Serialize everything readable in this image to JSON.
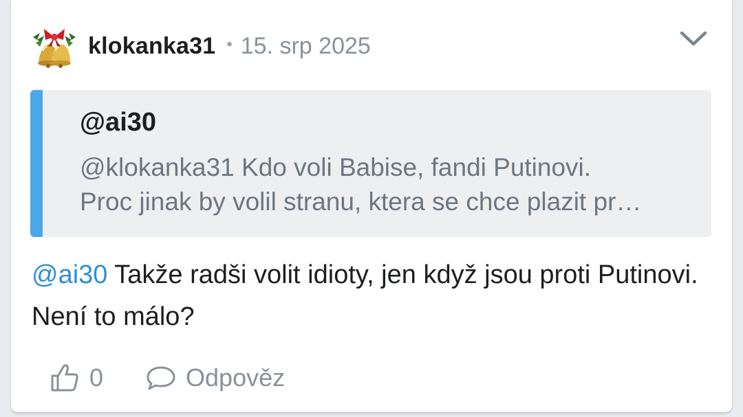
{
  "post": {
    "author": "klokanka31",
    "separator": "•",
    "date": "15. srp 2025",
    "avatar_icon": "christmas-bells-icon",
    "menu_icon": "chevron-down-icon"
  },
  "quote": {
    "author": "@ai30",
    "line1": "@klokanka31 Kdo voli Babise, fandi Putinovi.",
    "line2": "Proc jinak by volil stranu, ktera se chce plazit pr…",
    "accent_color": "#4aa8e8"
  },
  "reply": {
    "mention": "@ai30",
    "text": " Takže radši volit idioty, jen když jsou proti Putinovi. Není to málo?",
    "mention_color": "#2f8fd6"
  },
  "actions": {
    "like_icon": "thumbs-up-icon",
    "like_count": "0",
    "reply_icon": "speech-bubble-icon",
    "reply_label": "Odpověz"
  }
}
